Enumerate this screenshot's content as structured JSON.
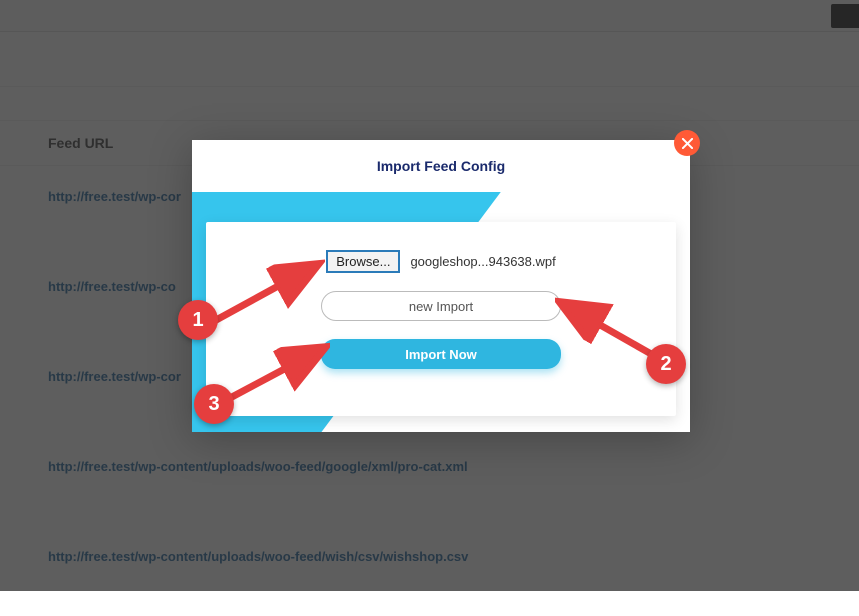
{
  "background": {
    "header": "Feed URL",
    "links": [
      "http://free.test/wp-cor",
      "http://free.test/wp-co",
      "http://free.test/wp-cor",
      "http://free.test/wp-content/uploads/woo-feed/google/xml/pro-cat.xml",
      "http://free.test/wp-content/uploads/woo-feed/wish/csv/wishshop.csv"
    ]
  },
  "modal": {
    "title": "Import Feed Config",
    "browse_label": "Browse...",
    "file_name": "googleshop...943638.wpf",
    "name_input_value": "new Import",
    "import_button_label": "Import Now"
  },
  "annotations": {
    "marker1": "1",
    "marker2": "2",
    "marker3": "3"
  },
  "colors": {
    "accent": "#2fb6e0",
    "danger": "#e53e3e",
    "close": "#ff5a36"
  }
}
